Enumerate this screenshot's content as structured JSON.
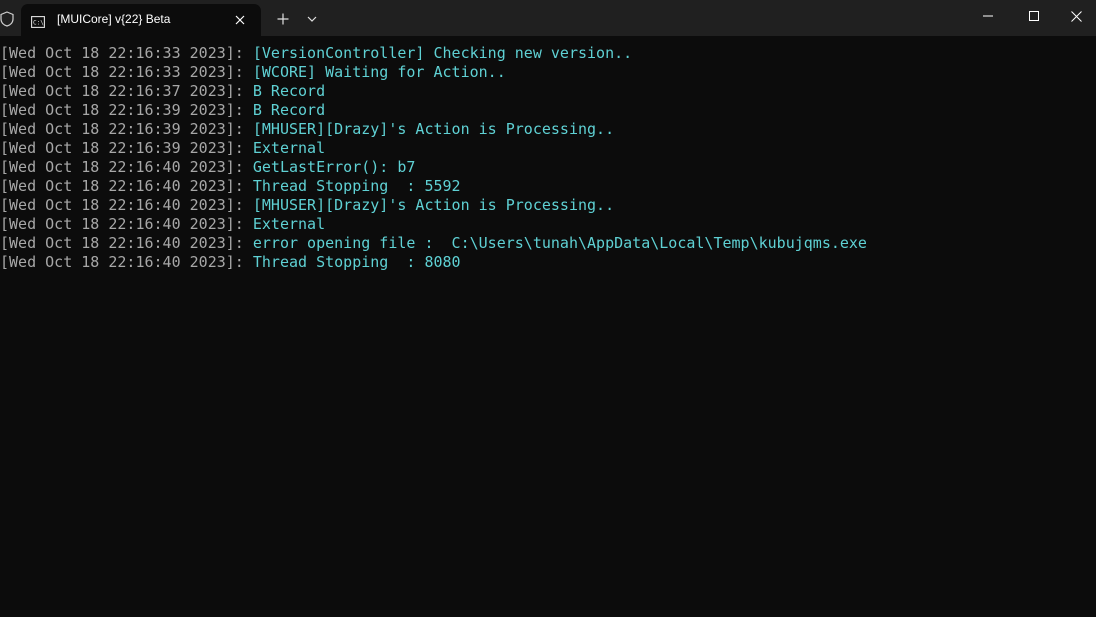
{
  "window": {
    "tab_title": "[MUICore] v{22} Beta",
    "icons": {
      "shield": "shield-icon",
      "terminal": "terminal-icon",
      "close": "close-icon",
      "new_tab": "plus-icon",
      "dropdown": "chevron-down-icon",
      "minimize": "minimize-icon",
      "maximize": "maximize-icon",
      "window_close": "close-icon"
    }
  },
  "colors": {
    "background": "#0c0c0c",
    "titlebar": "#202020",
    "timestamp": "#a7a7a7",
    "message": "#5fd1d4"
  },
  "console": {
    "lines": [
      {
        "ts": "[Wed Oct 18 22:16:33 2023]:",
        "msg": "[VersionController] Checking new version.."
      },
      {
        "ts": "[Wed Oct 18 22:16:33 2023]:",
        "msg": "[WCORE] Waiting for Action.."
      },
      {
        "ts": "[Wed Oct 18 22:16:37 2023]:",
        "msg": "B Record"
      },
      {
        "ts": "[Wed Oct 18 22:16:39 2023]:",
        "msg": "B Record"
      },
      {
        "ts": "[Wed Oct 18 22:16:39 2023]:",
        "msg": "[MHUSER][Drazy]'s Action is Processing.."
      },
      {
        "ts": "[Wed Oct 18 22:16:39 2023]:",
        "msg": "External"
      },
      {
        "ts": "[Wed Oct 18 22:16:40 2023]:",
        "msg": "GetLastError(): b7"
      },
      {
        "ts": "[Wed Oct 18 22:16:40 2023]:",
        "msg": "Thread Stopping  : 5592"
      },
      {
        "ts": "[Wed Oct 18 22:16:40 2023]:",
        "msg": "[MHUSER][Drazy]'s Action is Processing.."
      },
      {
        "ts": "[Wed Oct 18 22:16:40 2023]:",
        "msg": "External"
      },
      {
        "ts": "[Wed Oct 18 22:16:40 2023]:",
        "msg": "error opening file :  C:\\Users\\tunah\\AppData\\Local\\Temp\\kubujqms.exe"
      },
      {
        "ts": "[Wed Oct 18 22:16:40 2023]:",
        "msg": "Thread Stopping  : 8080"
      }
    ]
  }
}
